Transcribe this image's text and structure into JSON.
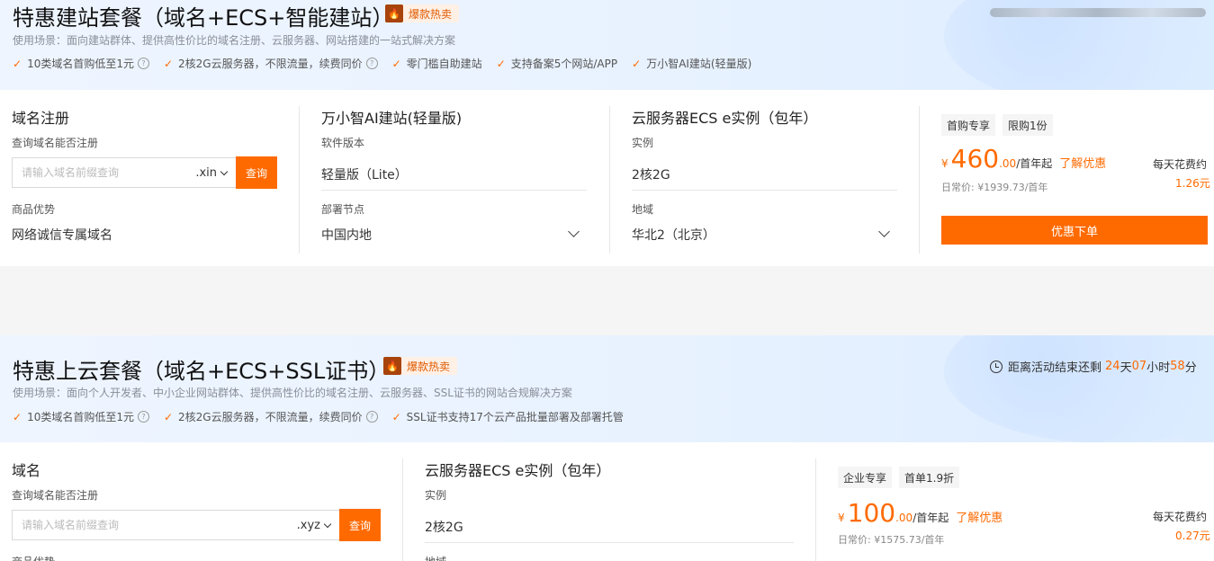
{
  "pkg1": {
    "title": "特惠建站套餐（域名+ECS+智能建站）",
    "badge": "爆款热卖",
    "scene": "使用场景：面向建站群体、提供高性价比的域名注册、云服务器、网站搭建的一站式解决方案",
    "features": [
      "10类域名首购低至1元",
      "2核2G云服务器，不限流量，续费同价",
      "零门槛自助建站",
      "支持备案5个网站/APP",
      "万小智AI建站(轻量版)"
    ],
    "col1": {
      "heading": "域名注册",
      "search_label": "查询域名能否注册",
      "placeholder": "请输入域名前缀查询",
      "suffix": ".xin",
      "search_btn": "查询",
      "adv_label": "商品优势",
      "adv_value": "网络诚信专属域名"
    },
    "col2": {
      "heading": "万小智AI建站(轻量版)",
      "version_label": "软件版本",
      "version_value": "轻量版（Lite）",
      "node_label": "部署节点",
      "node_value": "中国内地"
    },
    "col3": {
      "heading": "云服务器ECS e实例（包年）",
      "inst_label": "实例",
      "inst_value": "2核2G",
      "region_label": "地域",
      "region_value": "华北2（北京）"
    },
    "price": {
      "tag1": "首购专享",
      "tag2": "限购1份",
      "currency": "¥",
      "integer": "460",
      "decimal": ".00",
      "unit": "/首年起",
      "link": "了解优惠",
      "daily_label": "每天花费约",
      "daily_value": "1.26元",
      "original": "日常价: ¥1939.73/首年",
      "order_btn": "优惠下单"
    }
  },
  "pkg2": {
    "title": "特惠上云套餐（域名+ECS+SSL证书）",
    "badge": "爆款热卖",
    "timer": {
      "prefix": "距离活动结束还剩",
      "days": "24",
      "d": "天",
      "hours": "07",
      "h": "小时",
      "minutes": "58",
      "m": "分"
    },
    "scene": "使用场景：面向个人开发者、中小企业网站群体、提供高性价比的域名注册、云服务器、SSL证书的网站合规解决方案",
    "features": [
      "10类域名首购低至1元",
      "2核2G云服务器，不限流量，续费同价",
      "SSL证书支持17个云产品批量部署及部署托管"
    ],
    "col1": {
      "heading": "域名",
      "search_label": "查询域名能否注册",
      "placeholder": "请输入域名前缀查询",
      "suffix": ".xyz",
      "search_btn": "查询",
      "adv_label": "商品优势"
    },
    "col2": {
      "heading": "云服务器ECS e实例（包年）",
      "inst_label": "实例",
      "inst_value": "2核2G",
      "region_label": "地域"
    },
    "price": {
      "tag1": "企业专享",
      "tag2": "首单1.9折",
      "currency": "¥",
      "integer": "100",
      "decimal": ".00",
      "unit": "/首年起",
      "link": "了解优惠",
      "daily_label": "每天花费约",
      "daily_value": "0.27元",
      "original": "日常价: ¥1575.73/首年"
    }
  },
  "colors": {
    "accent": "#ff6a00",
    "hero_bg": "#eef5ff"
  },
  "icons": {
    "check": "check-icon",
    "help": "question-icon",
    "fire": "fire-icon",
    "clock": "clock-icon",
    "chevron": "chevron-down-icon"
  }
}
